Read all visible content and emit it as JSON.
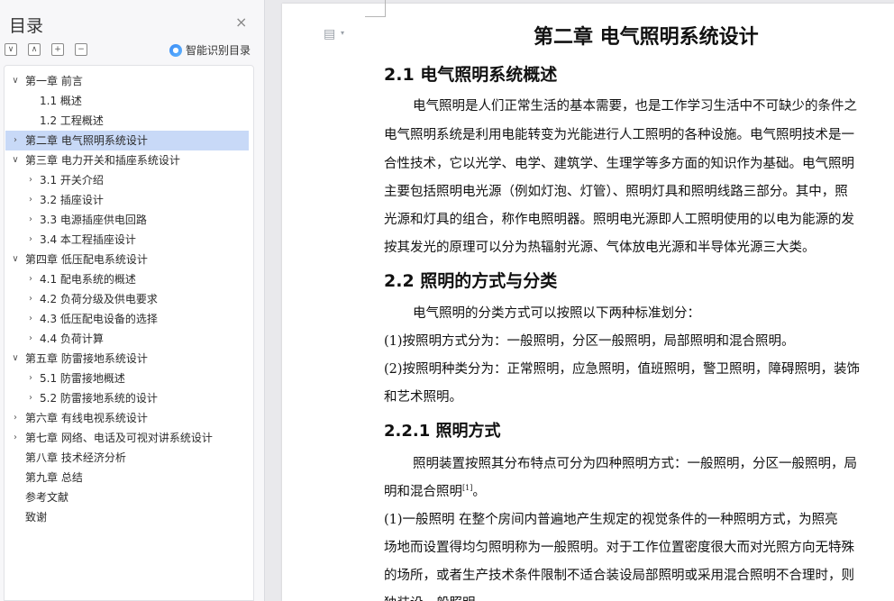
{
  "panel": {
    "title": "目录",
    "close_glyph": "×",
    "tool_buttons": [
      "∨",
      "∧",
      "+",
      "−"
    ],
    "smart_label": "智能识别目录"
  },
  "toc": [
    {
      "level": 1,
      "caret": "∨",
      "label": "第一章  前言"
    },
    {
      "level": 2,
      "caret": "",
      "label": "1.1  概述"
    },
    {
      "level": 2,
      "caret": "",
      "label": "1.2  工程概述"
    },
    {
      "level": 1,
      "caret": "›",
      "label": "第二章  电气照明系统设计",
      "selected": true
    },
    {
      "level": 1,
      "caret": "∨",
      "label": "第三章  电力开关和插座系统设计"
    },
    {
      "level": 2,
      "caret": "›",
      "label": "3.1  开关介绍"
    },
    {
      "level": 2,
      "caret": "›",
      "label": "3.2  插座设计"
    },
    {
      "level": 2,
      "caret": "›",
      "label": "3.3  电源插座供电回路"
    },
    {
      "level": 2,
      "caret": "›",
      "label": "3.4  本工程插座设计"
    },
    {
      "level": 1,
      "caret": "∨",
      "label": "第四章  低压配电系统设计"
    },
    {
      "level": 2,
      "caret": "›",
      "label": "4.1  配电系统的概述"
    },
    {
      "level": 2,
      "caret": "›",
      "label": "4.2  负荷分级及供电要求"
    },
    {
      "level": 2,
      "caret": "›",
      "label": "4.3  低压配电设备的选择"
    },
    {
      "level": 2,
      "caret": "›",
      "label": "4.4  负荷计算"
    },
    {
      "level": 1,
      "caret": "∨",
      "label": "第五章  防雷接地系统设计"
    },
    {
      "level": 2,
      "caret": "›",
      "label": "5.1  防雷接地概述"
    },
    {
      "level": 2,
      "caret": "›",
      "label": "5.2  防雷接地系统的设计"
    },
    {
      "level": 1,
      "caret": "›",
      "label": "第六章  有线电视系统设计"
    },
    {
      "level": 1,
      "caret": "›",
      "label": "第七章  网络、电话及可视对讲系统设计"
    },
    {
      "level": 1,
      "caret": "",
      "label": "第八章  技术经济分析"
    },
    {
      "level": 1,
      "caret": "",
      "label": "第九章  总结"
    },
    {
      "level": 1,
      "caret": "",
      "label": "参考文献"
    },
    {
      "level": 1,
      "caret": "",
      "label": "致谢"
    }
  ],
  "doc": {
    "chapter_title": "第二章  电气照明系统设计",
    "s21_title": "2.1  电气照明系统概述",
    "s21_lines": [
      "电气照明是人们正常生活的基本需要，也是工作学习生活中不可缺少的条件之",
      "电气照明系统是利用电能转变为光能进行人工照明的各种设施。电气照明技术是一",
      "合性技术，它以光学、电学、建筑学、生理学等多方面的知识作为基础。电气照明",
      "主要包括照明电光源（例如灯泡、灯管）、照明灯具和照明线路三部分。其中，照",
      "光源和灯具的组合，称作电照明器。照明电光源即人工照明使用的以电为能源的发",
      "按其发光的原理可以分为热辐射光源、气体放电光源和半导体光源三大类。"
    ],
    "s22_title": "2.2  照明的方式与分类",
    "s22_lines": [
      "电气照明的分类方式可以按照以下两种标准划分：",
      "(1)按照明方式分为：一般照明，分区一般照明，局部照明和混合照明。",
      "(2)按照明种类分为：正常照明，应急照明，值班照明，警卫照明，障碍照明，装饰",
      "和艺术照明。"
    ],
    "s221_title": "2.2.1  照明方式",
    "s221_lines": [
      "照明装置按照其分布特点可分为四种照明方式：一般照明，分区一般照明，局",
      "明和混合照明",
      "(1)一般照明    在整个房间内普遍地产生规定的视觉条件的一种照明方式，为照亮",
      "场地而设置得均匀照明称为一般照明。对于工作位置密度很大而对光照方向无特殊",
      "的场所，或者生产技术条件限制不适合装设局部照明或采用混合照明不合理时，则",
      "独装设一般照明。"
    ],
    "citation": "[1]",
    "citation_tail": "。"
  }
}
